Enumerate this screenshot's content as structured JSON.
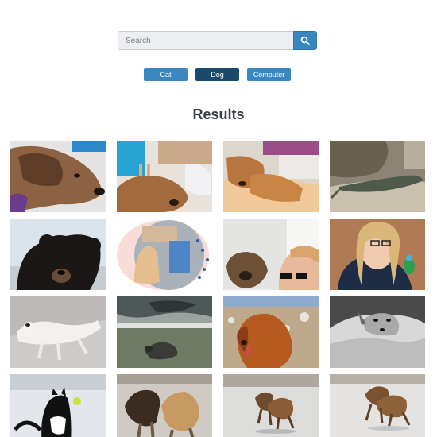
{
  "search": {
    "placeholder": "Search",
    "button_icon": "search-icon"
  },
  "filters": [
    {
      "label": "Cat",
      "color": "#3a87c0"
    },
    {
      "label": "Dog",
      "color": "#1b4a6b",
      "selected": true
    },
    {
      "label": "Computer",
      "color": "#3a87c0"
    }
  ],
  "results": {
    "title": "Results",
    "images": [
      {
        "subject": "brindle-dog-closeup"
      },
      {
        "subject": "dog-resting-on-bed"
      },
      {
        "subject": "dog-lying-on-blanket"
      },
      {
        "subject": "iguana-on-rock"
      },
      {
        "subject": "black-bear"
      },
      {
        "subject": "dog-beside-carrier-circle-frame"
      },
      {
        "subject": "dog-with-person-glasses"
      },
      {
        "subject": "woman-with-parrot"
      },
      {
        "subject": "small-white-dog-lying"
      },
      {
        "subject": "sheep-in-field"
      },
      {
        "subject": "spaniel-on-rocks"
      },
      {
        "subject": "dog-in-blanket-grayscale"
      },
      {
        "subject": "black-white-dog-with-ball"
      },
      {
        "subject": "dogs-playing-in-snow"
      },
      {
        "subject": "dogs-running-on-snow"
      },
      {
        "subject": "dogs-playing-on-snow-2"
      }
    ]
  }
}
